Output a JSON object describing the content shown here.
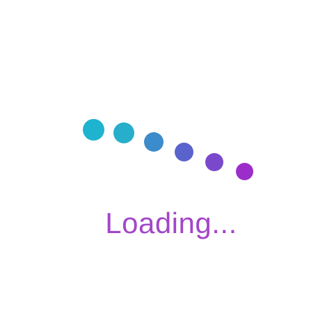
{
  "loader": {
    "text": "Loading...",
    "text_color": "#A346C9",
    "dot_colors": [
      "#1EB3CF",
      "#27AECB",
      "#3C8BCB",
      "#5A63CB",
      "#7A49CB",
      "#9B2ECB"
    ],
    "dot_count": 6
  }
}
